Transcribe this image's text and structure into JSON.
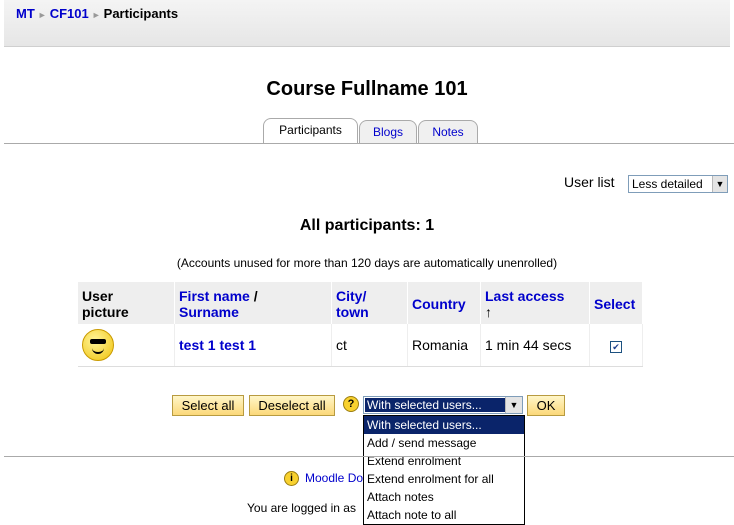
{
  "breadcrumb": {
    "items": [
      "MT",
      "CF101",
      "Participants"
    ]
  },
  "course": {
    "title": "Course Fullname 101"
  },
  "tabs": [
    {
      "label": "Participants"
    },
    {
      "label": "Blogs"
    },
    {
      "label": "Notes"
    }
  ],
  "userlist": {
    "label": "User list",
    "selected": "Less detailed"
  },
  "participants": {
    "heading": "All participants: 1",
    "note": "(Accounts unused for more than 120 days are automatically unenrolled)"
  },
  "table": {
    "headers": {
      "picture_line1": "User",
      "picture_line2": "picture",
      "firstname": "First name",
      "slash": " /",
      "surname": "Surname",
      "city_line1": "City/",
      "city_line2": "town",
      "country": "Country",
      "last_access": "Last access",
      "sort_arrow": "↑",
      "select": "Select"
    },
    "rows": [
      {
        "name": "test 1 test 1",
        "city": "ct",
        "country": "Romania",
        "last_access": "1 min 44 secs",
        "checked": "✔"
      }
    ]
  },
  "actions": {
    "select_all": "Select all",
    "deselect_all": "Deselect all",
    "help": "?",
    "with_selected": "With selected users...",
    "ok": "OK",
    "options": [
      "With selected users...",
      "Add / send message",
      "Extend enrolment",
      "Extend enrolment for all",
      "Attach notes",
      "Attach note to all"
    ]
  },
  "footer": {
    "docs_link": "Moodle Do",
    "docs_icon": "i",
    "logged_in": "You are logged in as"
  },
  "icons": {
    "breadcrumb_separator": "►",
    "dropdown_arrow": "▼"
  }
}
